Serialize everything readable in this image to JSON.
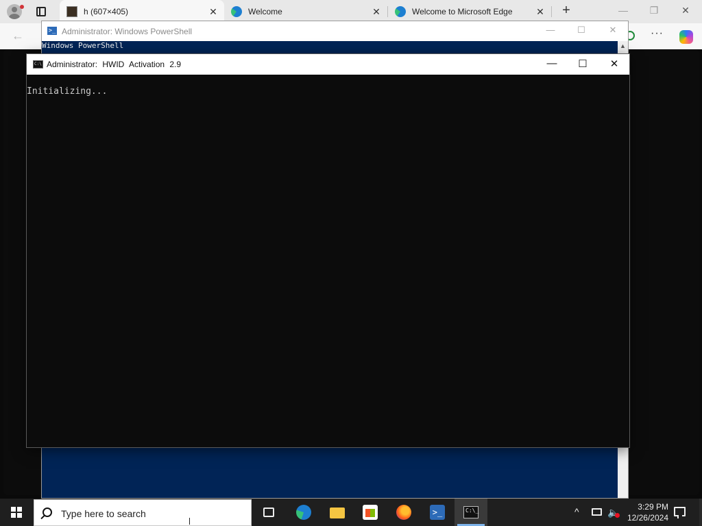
{
  "browser": {
    "tabs": [
      {
        "title": "h (607×405)",
        "close": "✕",
        "icon": "image-favicon-icon",
        "active": true
      },
      {
        "title": "Welcome",
        "close": "✕",
        "icon": "edge-favicon-icon",
        "active": false
      },
      {
        "title": "Welcome to Microsoft Edge",
        "close": "✕",
        "icon": "edge-favicon-icon",
        "active": false
      }
    ],
    "new_tab": "+",
    "window_controls": {
      "minimize": "—",
      "restore": "❐",
      "close": "✕"
    },
    "toolbar": {
      "back": "←",
      "more": "···"
    }
  },
  "powershell": {
    "title": "Administrator: Windows PowerShell",
    "console_lines": [
      "Windows PowerShell"
    ],
    "controls": {
      "minimize": "—",
      "maximize": "☐",
      "close": "✕"
    },
    "scroll_up": "▲"
  },
  "cmd": {
    "title": "Administrator:  HWID Activation 2.9",
    "console_text": "Initializing...",
    "controls": {
      "minimize": "—",
      "maximize": "☐",
      "close": "✕"
    },
    "icon_text": "C:\\"
  },
  "taskbar": {
    "search_placeholder": "Type here to search",
    "pinned": [
      "task-view-icon",
      "edge-icon",
      "file-explorer-icon",
      "store-icon",
      "firefox-icon",
      "powershell-icon",
      "cmd-icon"
    ],
    "ps_glyph": ">_",
    "cmd_glyph": "C:\\_",
    "tray": {
      "chevron": "^",
      "volume": "🔈",
      "time": "3:29 PM",
      "date": "12/26/2024"
    }
  },
  "colors": {
    "powershell_bg": "#012456",
    "console_bg": "#0c0c0c",
    "taskbar_bg": "#1f1f1f",
    "active_indicator": "#7eb4ea"
  }
}
